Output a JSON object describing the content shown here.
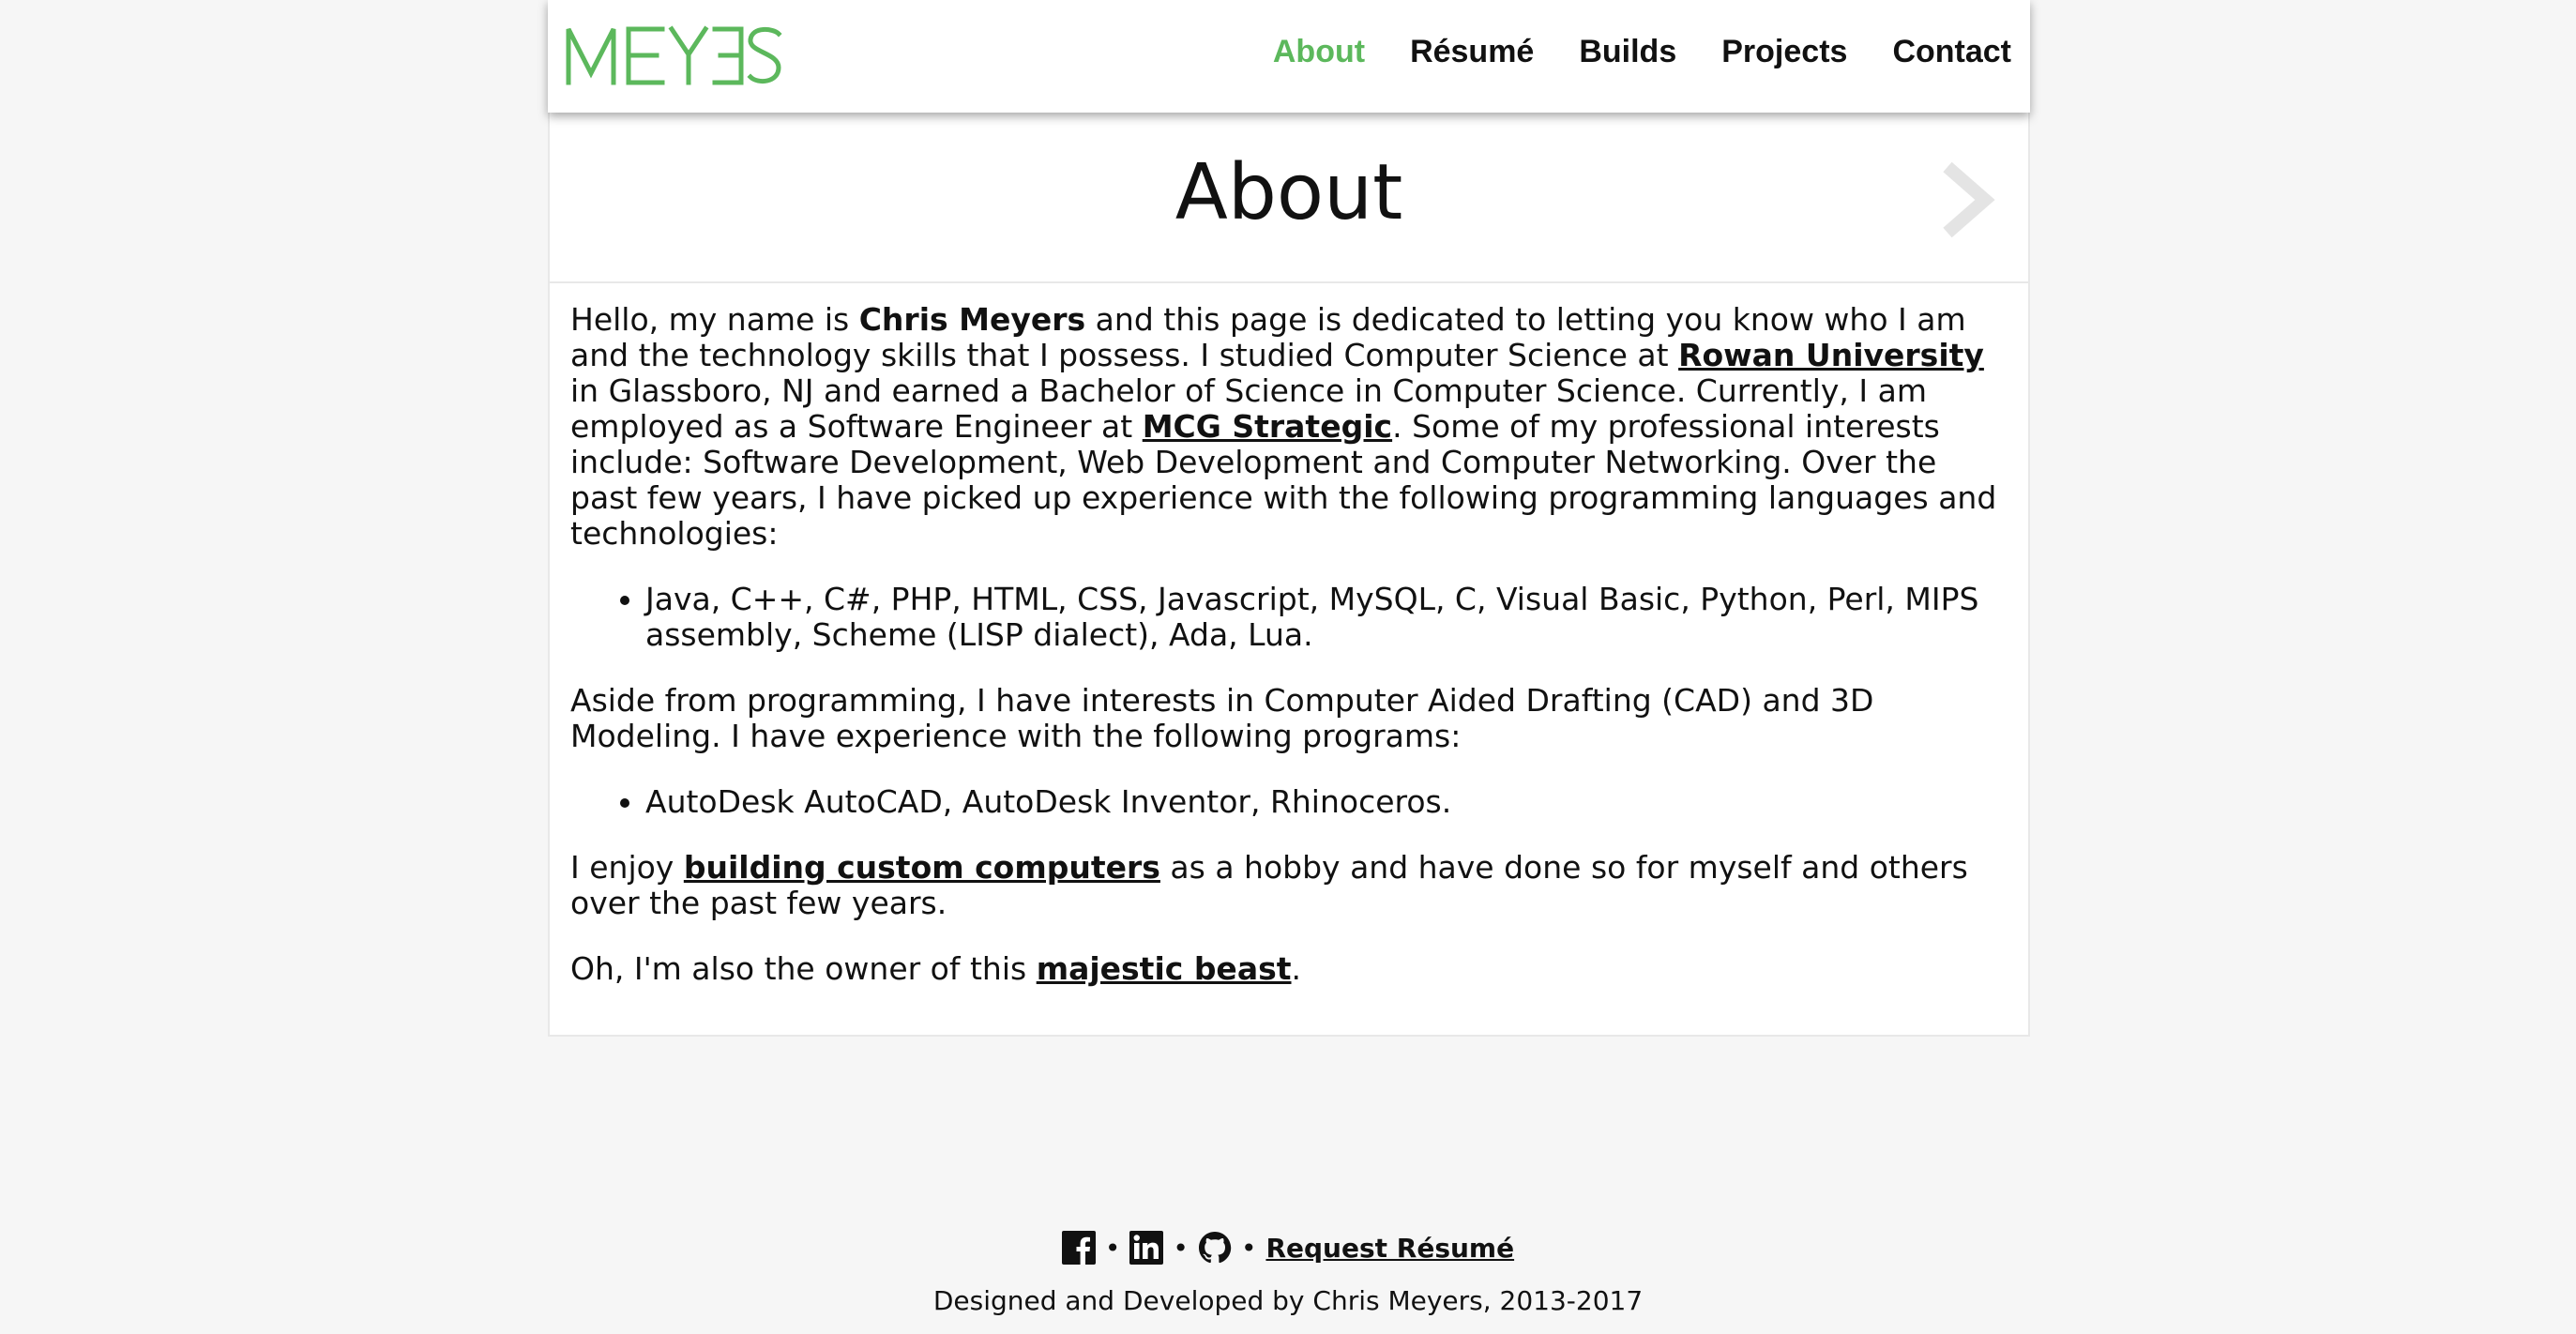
{
  "site": {
    "logo_text": "MEYERS",
    "brand_color": "#5cb85c"
  },
  "nav": {
    "items": [
      {
        "label": "About",
        "active": true
      },
      {
        "label": "Résumé",
        "active": false
      },
      {
        "label": "Builds",
        "active": false
      },
      {
        "label": "Projects",
        "active": false
      },
      {
        "label": "Contact",
        "active": false
      }
    ]
  },
  "page": {
    "title": "About",
    "next_icon": "chevron-right-icon"
  },
  "content": {
    "p1": {
      "t1": "Hello, my name is ",
      "name": "Chris Meyers",
      "t2": " and this page is dedicated to letting you know who I am and the technology skills that I possess. I studied Computer Science at ",
      "link_university": "Rowan University",
      "t3": " in Glassboro, NJ and earned a Bachelor of Science in Computer Science. Currently, I am employed as a Software Engineer at ",
      "link_employer": "MCG Strategic",
      "t4": ". Some of my professional interests include: Software Development, Web Development and Computer Networking. Over the past few years, I have picked up experience with the following programming languages and technologies:"
    },
    "list1": [
      "Java, C++, C#, PHP, HTML, CSS, Javascript, MySQL, C, Visual Basic, Python, Perl, MIPS assembly, Scheme (LISP dialect), Ada, Lua."
    ],
    "p2": "Aside from programming, I have interests in Computer Aided Drafting (CAD) and 3D Modeling. I have experience with the following programs:",
    "list2": [
      "AutoDesk AutoCAD, AutoDesk Inventor, Rhinoceros."
    ],
    "p3": {
      "t1": "I enjoy ",
      "link": "building custom computers",
      "t2": " as a hobby and have done so for myself and others over the past few years."
    },
    "p4": {
      "t1": "Oh, I'm also the owner of this ",
      "link": "majestic beast",
      "t2": "."
    }
  },
  "footer": {
    "icons": [
      "facebook-icon",
      "linkedin-icon",
      "github-icon"
    ],
    "separator": "•",
    "request_resume": "Request Résumé",
    "credit": "Designed and Developed by Chris Meyers, 2013-2017"
  }
}
